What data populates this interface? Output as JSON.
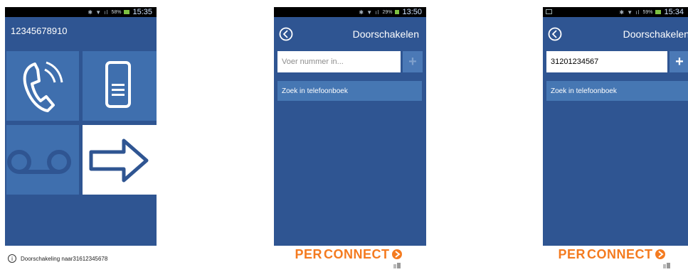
{
  "phone1": {
    "status_time": "15:35",
    "status_battery": "58%",
    "number": "12345678910",
    "tiles": [
      "phone-icon",
      "document-icon",
      "voicemail-icon",
      "forward-arrow-icon"
    ]
  },
  "phone2": {
    "status_time": "13:50",
    "status_battery": "29%",
    "title": "Doorschakelen",
    "input_value": "",
    "input_placeholder": "Voer nummer in...",
    "plus_label": "+",
    "phonebook_label": "Zoek in telefoonboek"
  },
  "phone3": {
    "status_time": "15:34",
    "status_battery": "59%",
    "title": "Doorschakelen",
    "input_value": "31201234567",
    "plus_label": "+",
    "phonebook_label": "Zoek in telefoonboek"
  },
  "logo": {
    "text_part1": "PER",
    "text_part2": "CONNECT"
  },
  "footer": {
    "info_glyph": "i",
    "text_prefix": "Doorschakeling naar ",
    "text_number": "31612345678"
  },
  "colors": {
    "app_bg": "#2f5592",
    "tile_blue": "#3f6fae",
    "list_item": "#4677b3",
    "brand_orange": "#f47b20"
  }
}
